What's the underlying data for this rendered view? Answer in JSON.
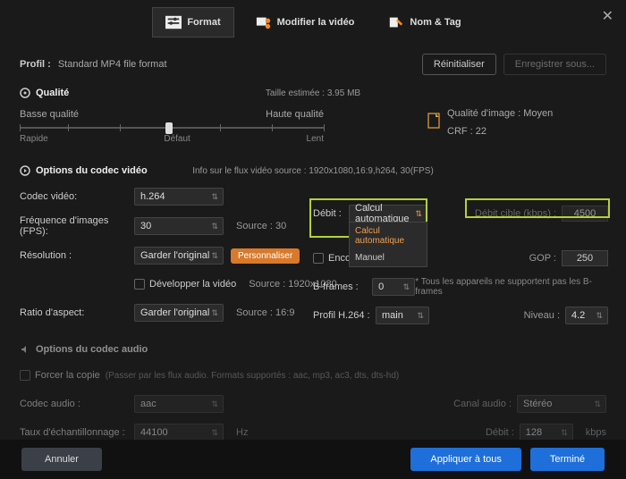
{
  "close_glyph": "✕",
  "tabs": {
    "format": "Format",
    "modify": "Modifier la vidéo",
    "name": "Nom & Tag"
  },
  "profile": {
    "label": "Profil :",
    "value": "Standard MP4 file format",
    "reset": "Réinitialiser",
    "saveas": "Enregistrer sous..."
  },
  "quality": {
    "title": "Qualité",
    "estimate": "Taille estimée : 3.95 MB",
    "low": "Basse qualité",
    "high": "Haute qualité",
    "fast": "Rapide",
    "default": "Défaut",
    "slow": "Lent",
    "imgq_label": "Qualité d'image :",
    "imgq_value": "Moyen",
    "crf_label": "CRF :",
    "crf_value": "22"
  },
  "video": {
    "title": "Options du codec vidéo",
    "stream_info": "Info sur le flux vidéo source : 1920x1080,16:9,h264, 30(FPS)",
    "codec_label": "Codec vidéo:",
    "codec_value": "h.264",
    "fps_label": "Fréquence d'images (FPS):",
    "fps_value": "30",
    "fps_src": "Source : 30",
    "res_label": "Résolution :",
    "res_value": "Garder l'original",
    "res_src": "Source : 1920x1080",
    "customize": "Personnaliser",
    "enlarge": "Développer la vidéo",
    "ratio_label": "Ratio d'aspect:",
    "ratio_value": "Garder l'original",
    "ratio_src": "Source : 16:9",
    "bitrate_label": "Débit :",
    "bitrate_value": "Calcul automatique",
    "bitrate_opts": {
      "auto": "Calcul automatique",
      "manual": "Manuel"
    },
    "target_label": "Débit cible (kbps) :",
    "target_value": "4500",
    "twopass": "Encodage 2-pass",
    "gop_label": "GOP :",
    "gop_value": "250",
    "bframes_label": "B-frames :",
    "bframes_value": "0",
    "bframes_note": "* Tous les appareils ne supportent pas les B-frames",
    "profile_label": "Profil H.264 :",
    "profile_value": "main",
    "level_label": "Niveau :",
    "level_value": "4.2"
  },
  "audio": {
    "title": "Options du codec audio",
    "force": "Forcer la copie",
    "force_note": "(Passer par les flux audio. Formats supportés : aac, mp3, ac3, dts, dts-hd)",
    "codec_label": "Codec audio :",
    "codec_value": "aac",
    "channel_label": "Canal audio :",
    "channel_value": "Stéréo",
    "rate_label": "Taux d'échantillonnage :",
    "rate_value": "44100",
    "rate_unit": "Hz",
    "bitrate_label": "Débit :",
    "bitrate_value": "128",
    "bitrate_unit": "kbps"
  },
  "footer": {
    "cancel": "Annuler",
    "apply_all": "Appliquer à tous",
    "done": "Terminé"
  }
}
